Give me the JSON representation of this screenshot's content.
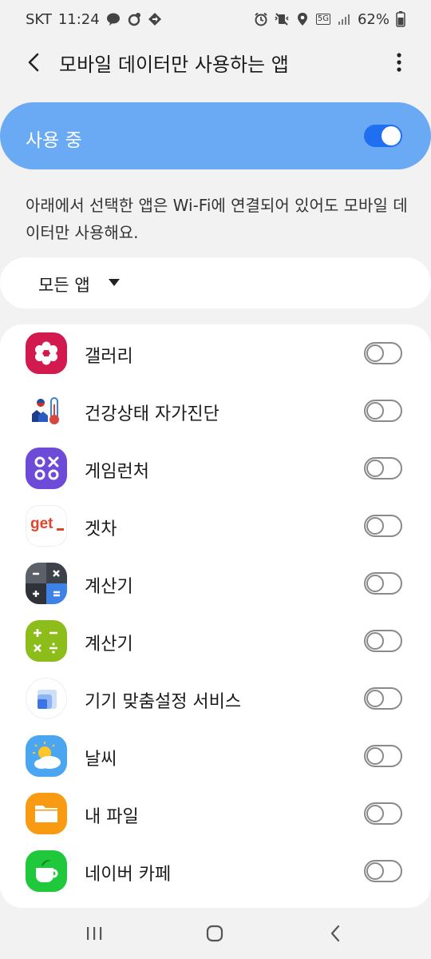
{
  "status_bar": {
    "carrier": "SKT",
    "time": "11:24",
    "network": "5G",
    "battery": "62%",
    "left_icons": [
      "talk-icon",
      "location-share-icon",
      "navigation-icon"
    ],
    "right_icons": [
      "alarm-icon",
      "vibrate-mute-icon",
      "location-icon",
      "network-5g-icon",
      "signal-icon",
      "battery-icon"
    ]
  },
  "app_bar": {
    "title": "모바일 데이터만 사용하는 앱",
    "back_icon": "back-arrow-icon",
    "more_icon": "more-vert-icon"
  },
  "master_switch": {
    "label": "사용 중",
    "on": true,
    "accent": "#6aaaf5",
    "track_color": "#1f6ff0"
  },
  "description": "아래에서 선택한 앱은 Wi-Fi에 연결되어 있어도 모바일 데이터만 사용해요.",
  "filter": {
    "selected": "모든 앱"
  },
  "apps": [
    {
      "name": "갤러리",
      "icon": "gallery-icon",
      "enabled": false
    },
    {
      "name": "건강상태 자가진단",
      "icon": "health-check-icon",
      "enabled": false
    },
    {
      "name": "게임런처",
      "icon": "game-launcher-icon",
      "enabled": false
    },
    {
      "name": "겟차",
      "icon": "getcha-icon",
      "icon_text": "get",
      "enabled": false
    },
    {
      "name": "계산기",
      "icon": "calculator-icon",
      "enabled": false
    },
    {
      "name": "계산기",
      "icon": "calculator-green-icon",
      "enabled": false
    },
    {
      "name": "기기 맞춤설정 서비스",
      "icon": "customization-service-icon",
      "enabled": false
    },
    {
      "name": "날씨",
      "icon": "weather-icon",
      "enabled": false
    },
    {
      "name": "내 파일",
      "icon": "my-files-icon",
      "enabled": false
    },
    {
      "name": "네이버 카페",
      "icon": "naver-cafe-icon",
      "enabled": false
    }
  ],
  "nav_bar": {
    "recents_icon": "recents-icon",
    "home_icon": "home-icon",
    "back_icon": "nav-back-icon"
  }
}
